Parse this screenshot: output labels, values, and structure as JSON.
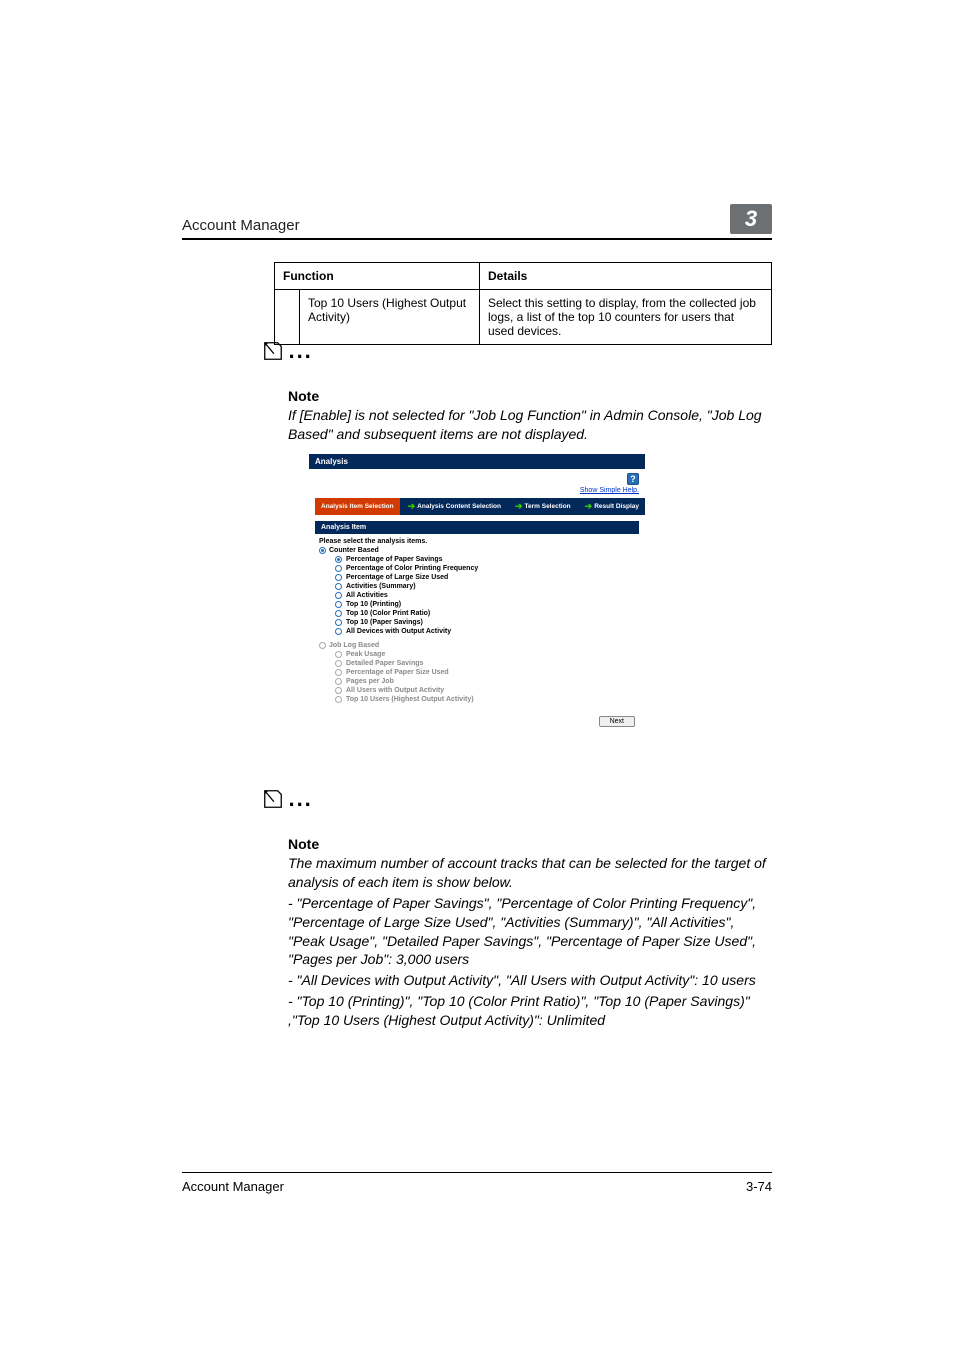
{
  "header": {
    "title": "Account Manager",
    "chapter": "3"
  },
  "table": {
    "headers": {
      "function": "Function",
      "details": "Details"
    },
    "rows": [
      {
        "function": "Top 10 Users (Highest Output Activity)",
        "details": "Select this setting to display, from the collected job logs, a list of the top 10 counters for users that used devices."
      }
    ]
  },
  "note1": {
    "label": "Note",
    "body": "If [Enable] is not selected for \"Job Log Function\" in Admin Console, \"Job Log Based\" and subsequent items are not displayed."
  },
  "shot": {
    "title": "Analysis",
    "help_link": "Show Simple Help.",
    "crumbs": {
      "c1": "Analysis Item Selection",
      "c2": "Analysis Content Selection",
      "c3": "Term Selection",
      "c4": "Result Display"
    },
    "section": "Analysis Item",
    "prompt": "Please select the analysis items.",
    "group_counter": "Counter Based",
    "counter_items": [
      "Percentage of Paper Savings",
      "Percentage of Color Printing Frequency",
      "Percentage of Large Size Used",
      "Activities (Summary)",
      "All Activities",
      "Top 10 (Printing)",
      "Top 10 (Color Print Ratio)",
      "Top 10 (Paper Savings)",
      "All Devices with Output Activity"
    ],
    "group_joblog": "Job Log Based",
    "joblog_items": [
      "Peak Usage",
      "Detailed Paper Savings",
      "Percentage of Paper Size Used",
      "Pages per Job",
      "All Users with Output Activity",
      "Top 10 Users (Highest Output Activity)"
    ],
    "next_btn": "Next"
  },
  "note2": {
    "label": "Note",
    "l1": "The maximum number of account tracks that can be selected for the target of analysis of each item is show below.",
    "l2": "- \"Percentage of Paper Savings\", \"Percentage of Color Printing Frequency\", \"Percentage of Large Size Used\", \"Activities (Summary)\", \"All Activities\", \"Peak Usage\", \"Detailed Paper Savings\", \"Percentage of Paper Size Used\", \"Pages per Job\": 3,000 users",
    "l3": "- \"All Devices with Output Activity\", \"All Users with Output Activity\": 10 users",
    "l4": "- \"Top 10 (Printing)\", \"Top 10 (Color Print Ratio)\", \"Top 10 (Paper Savings)\" ,\"Top 10 Users (Highest Output Activity)\": Unlimited"
  },
  "footer": {
    "left": "Account Manager",
    "right": "3-74"
  }
}
